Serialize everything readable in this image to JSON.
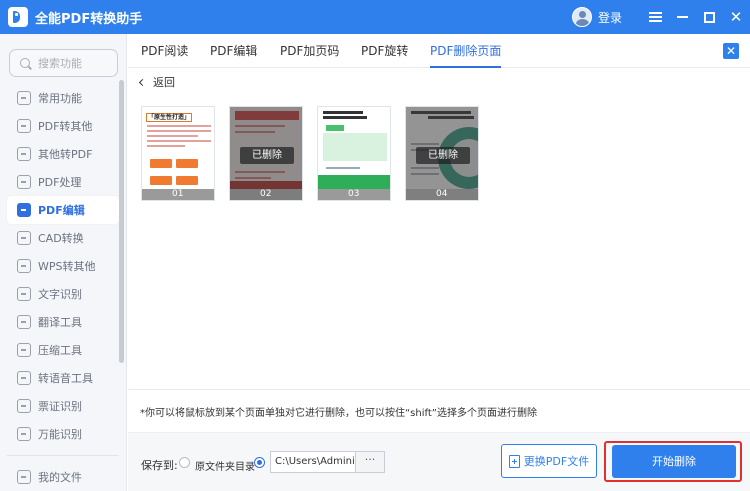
{
  "app": {
    "title": "全能PDF转换助手",
    "login": "登录"
  },
  "sidebar": {
    "search_placeholder": "搜索功能",
    "items": [
      {
        "label": "常用功能",
        "icon": "home-icon"
      },
      {
        "label": "PDF转其他",
        "icon": "pdf-export-icon"
      },
      {
        "label": "其他转PDF",
        "icon": "pdf-import-icon"
      },
      {
        "label": "PDF处理",
        "icon": "pdf-process-icon"
      },
      {
        "label": "PDF编辑",
        "icon": "pdf-edit-icon",
        "active": true
      },
      {
        "label": "CAD转换",
        "icon": "cad-icon"
      },
      {
        "label": "WPS转其他",
        "icon": "wps-icon"
      },
      {
        "label": "文字识别",
        "icon": "ocr-icon"
      },
      {
        "label": "翻译工具",
        "icon": "translate-icon"
      },
      {
        "label": "压缩工具",
        "icon": "compress-icon"
      },
      {
        "label": "转语音工具",
        "icon": "speech-icon"
      },
      {
        "label": "票证识别",
        "icon": "ticket-icon"
      },
      {
        "label": "万能识别",
        "icon": "universal-ocr-icon"
      }
    ],
    "my_files": "我的文件"
  },
  "tabs": [
    "PDF阅读",
    "PDF编辑",
    "PDF加页码",
    "PDF旋转",
    "PDF删除页面"
  ],
  "active_tab": "PDF删除页面",
  "back_label": "返回",
  "pages": [
    {
      "num": "01",
      "deleted": false,
      "title": "「原生性打造」"
    },
    {
      "num": "02",
      "deleted": true,
      "title": "21世纪中国消费品牌"
    },
    {
      "num": "03",
      "deleted": false,
      "title": "IMPROVISATION IS FULL PROMPT AND STIMULAT"
    },
    {
      "num": "04",
      "deleted": true,
      "title": "WHAT IMPRESSIONS HAVE TO INDUSTRY"
    }
  ],
  "deleted_badge": "已删除",
  "tip": "*你可以将鼠标放到某个页面单独对它进行删除，也可以按住“shift”选择多个页面进行删除",
  "footer": {
    "save_to": "保存到:",
    "option_source": "原文件夹目录",
    "path_value": "C:\\Users\\Adminis...",
    "path_more": "···",
    "replace_button": "更换PDF文件",
    "start_button": "开始删除"
  },
  "colors": {
    "accent": "#2f80ed",
    "highlight_border": "#e03030"
  }
}
